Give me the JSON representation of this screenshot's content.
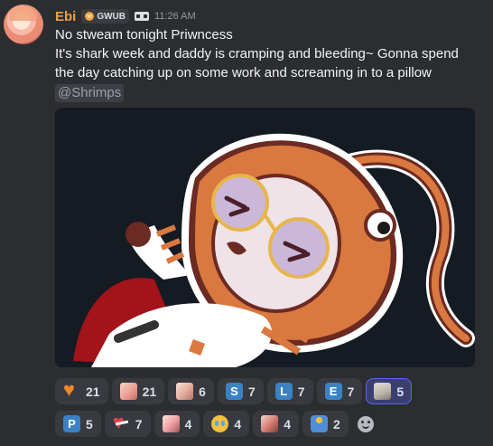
{
  "message": {
    "author": "Ebi",
    "clan_tag": "GWUB",
    "timestamp": "11:26 AM",
    "lines": [
      "No stweam tonight Priwncess",
      "It's shark week and daddy is cramping and bleeding~ Gonna spend",
      "the day catching up on some work and screaming in to a pillow"
    ],
    "mention": "@Shrimps",
    "author_color": "#f0a142"
  },
  "reactions_row1": [
    {
      "icon": "orange-heart-icon",
      "count": "21"
    },
    {
      "icon": "anime-face-emoji-icon",
      "count": "21"
    },
    {
      "icon": "anime-blush-emoji-icon",
      "count": "6"
    },
    {
      "key": "S",
      "count": "7"
    },
    {
      "key": "L",
      "count": "7"
    },
    {
      "key": "E",
      "count": "7"
    },
    {
      "icon": "cat-emoji-icon",
      "count": "5",
      "active": true
    }
  ],
  "reactions_row2": [
    {
      "key": "P",
      "count": "5"
    },
    {
      "icon": "bandaged-heart-icon",
      "count": "7"
    },
    {
      "icon": "anime-girl-emoji-icon",
      "count": "4"
    },
    {
      "icon": "crying-face-icon",
      "count": "4"
    },
    {
      "icon": "anime-sad-emoji-icon",
      "count": "4"
    },
    {
      "icon": "people-hugging-icon",
      "count": "2"
    }
  ],
  "colors": {
    "background": "#2b2d31",
    "reaction_bg": "#383a40",
    "active_reaction_border": "#5865f2",
    "key_blue": "#3b82c4"
  }
}
